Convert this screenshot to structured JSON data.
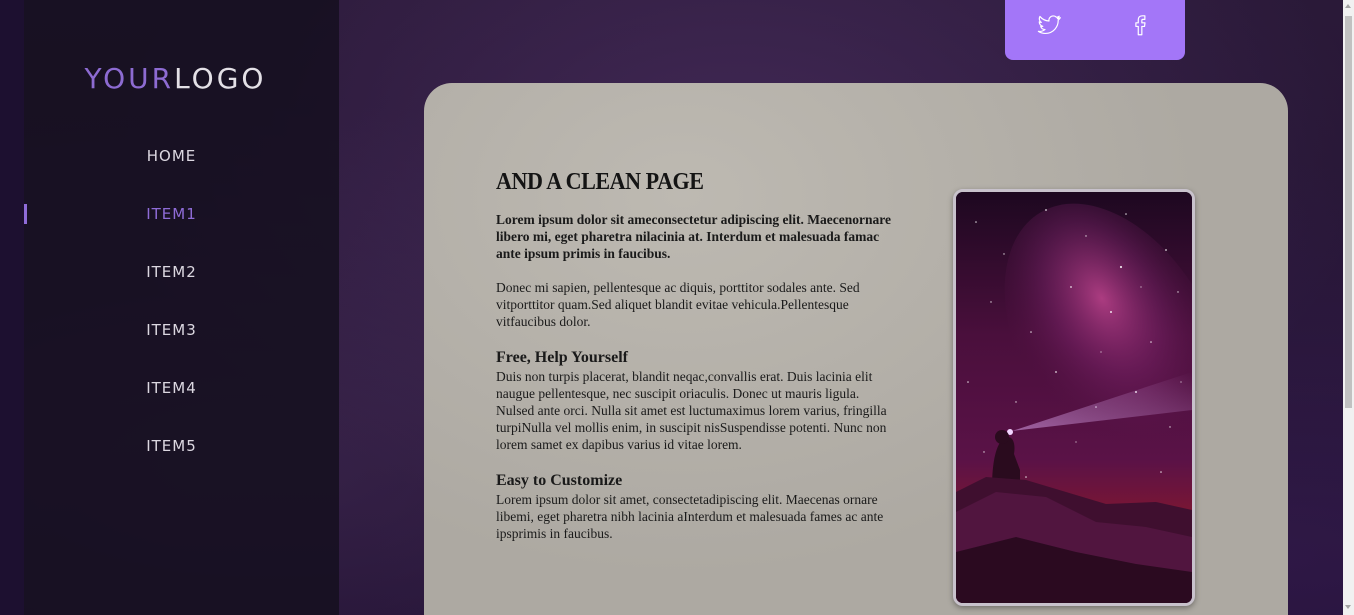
{
  "logo": {
    "part1": "YOUR",
    "part2": "LOGO"
  },
  "nav": {
    "items": [
      {
        "label": "HOME"
      },
      {
        "label": "ITEM1"
      },
      {
        "label": "ITEM2"
      },
      {
        "label": "ITEM3"
      },
      {
        "label": "ITEM4"
      },
      {
        "label": "ITEM5"
      }
    ],
    "active_index": 1
  },
  "social": {
    "icons": [
      "twitter-icon",
      "facebook-icon"
    ]
  },
  "main": {
    "title": "AND A CLEAN PAGE",
    "lead": "Lorem ipsum dolor sit ameconsectetur adipiscing elit. Maecenornare libero mi, eget pharetra nilacinia at. Interdum et malesuada famac ante ipsum primis in faucibus.",
    "paragraph": "Donec mi sapien, pellentesque ac diquis, porttitor sodales ante. Sed vitporttitor quam.Sed aliquet blandit evitae vehicula.Pellentesque vitfaucibus dolor.",
    "sections": [
      {
        "heading": "Free, Help Yourself",
        "text": "Duis non turpis placerat, blandit neqac,convallis erat. Duis lacinia elit naugue pellentesque, nec suscipit oriaculis. Donec ut mauris ligula. Nulsed ante orci. Nulla sit amet est luctumaximus lorem varius, fringilla turpiNulla vel mollis enim, in suscipit nisSuspendisse potenti. Nunc non lorem samet ex dapibus varius id vitae lorem."
      },
      {
        "heading": "Easy to Customize",
        "text": "Lorem ipsum dolor sit amet, consectetadipiscing elit. Maecenas ornare libemi, eget pharetra nibh lacinia aInterdum et malesuada fames ac ante ipsprimis in faucibus."
      }
    ]
  },
  "colors": {
    "accent": "#8f6cd8",
    "social_bg": "#a376f8",
    "panel_bg": "#ada9a2",
    "sidebar_bg": "#161020"
  }
}
